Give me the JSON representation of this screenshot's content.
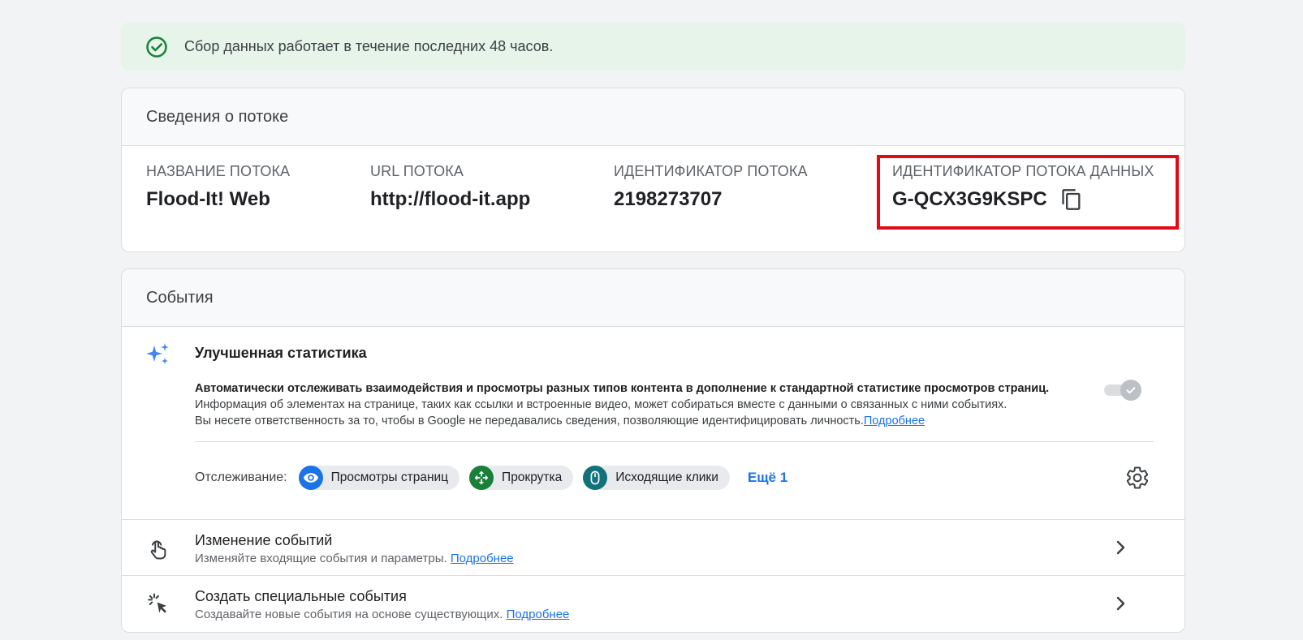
{
  "banner": {
    "text": "Сбор данных работает в течение последних 48 часов."
  },
  "stream": {
    "title": "Сведения о потоке",
    "name_label": "НАЗВАНИЕ ПОТОКА",
    "name_value": "Flood-It! Web",
    "url_label": "URL ПОТОКА",
    "url_value": "http://flood-it.app",
    "id_label": "ИДЕНТИФИКАТОР ПОТОКА",
    "id_value": "2198273707",
    "measurement_label": "ИДЕНТИФИКАТОР ПОТОКА ДАННЫХ",
    "measurement_value": "G-QCX3G9KSPC"
  },
  "events": {
    "title": "События",
    "enhanced": {
      "title": "Улучшенная статистика",
      "desc_bold": "Автоматически отслеживать взаимодействия и просмотры разных типов контента в дополнение к стандартной статистике просмотров страниц.",
      "desc_line2": "Информация об элементах на странице, таких как ссылки и встроенные видео, может собираться вместе с данными о связанных с ними событиях.",
      "desc_line3": "Вы несете ответственность за то, чтобы в Google не передавались сведения, позволяющие идентифицировать личность.",
      "link": "Подробнее",
      "tracking_label": "Отслеживание:",
      "chips": [
        "Просмотры страниц",
        "Прокрутка",
        "Исходящие клики"
      ],
      "more": "Ещё 1"
    },
    "modify": {
      "title": "Изменение событий",
      "subtitle": "Изменяйте входящие события и параметры.",
      "link": "Подробнее"
    },
    "create": {
      "title": "Создать специальные события",
      "subtitle": "Создавайте новые события на основе существующих.",
      "link": "Подробнее"
    }
  },
  "colors": {
    "accent": "#1a73e8",
    "success": "#188038",
    "highlight": "#e50914",
    "chip_pageviews": "#1a73e8",
    "chip_scroll": "#188038",
    "chip_outbound": "#12727c"
  }
}
